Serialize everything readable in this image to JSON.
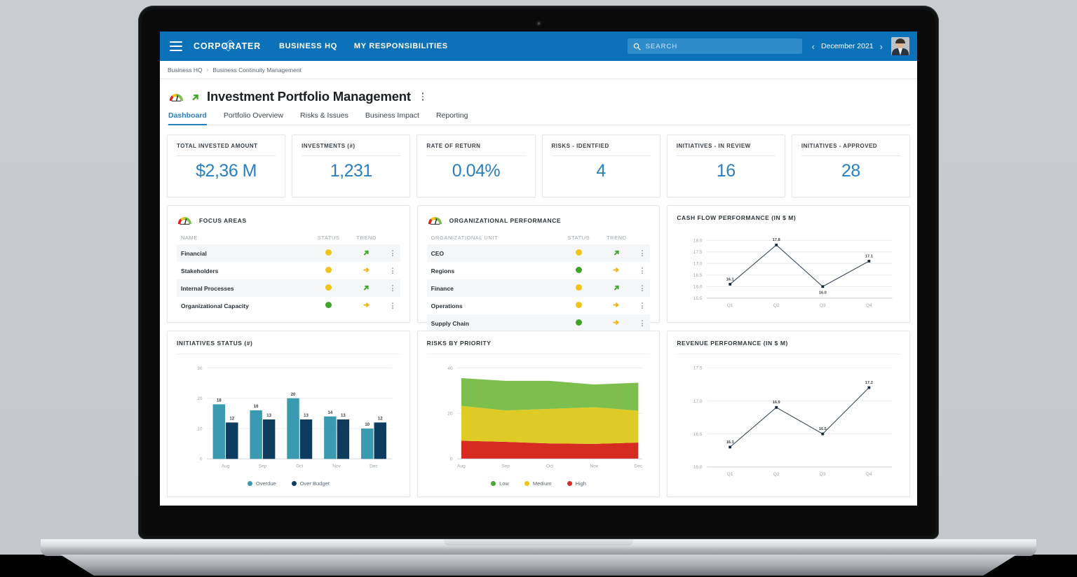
{
  "topbar": {
    "menu_icon": "hamburger-icon",
    "brand": "CORPORATER",
    "nav": [
      "BUSINESS HQ",
      "MY RESPONSIBILITIES"
    ],
    "search": {
      "icon": "search-icon",
      "placeholder": "SEARCH",
      "value": ""
    },
    "period": {
      "prev_icon": "chevron-left-icon",
      "label": "December 2021",
      "next_icon": "chevron-right-icon"
    },
    "avatar": "user-avatar"
  },
  "breadcrumb": {
    "items": [
      "Business HQ",
      "Business Continuity Management"
    ],
    "separator": "›"
  },
  "page": {
    "gauge_icon": "gauge-icon",
    "trend_icon": "arrow-up-right-icon",
    "title": "Investment Portfolio Management",
    "menu_icon": "kebab-menu-icon"
  },
  "tabs": [
    {
      "label": "Dashboard",
      "active": true
    },
    {
      "label": "Portfolio Overview",
      "active": false
    },
    {
      "label": "Risks & Issues",
      "active": false
    },
    {
      "label": "Business Impact",
      "active": false
    },
    {
      "label": "Reporting",
      "active": false
    }
  ],
  "kpis": [
    {
      "label": "TOTAL INVESTED AMOUNT",
      "value": "$2,36 M"
    },
    {
      "label": "INVESTMENTS (#)",
      "value": "1,231"
    },
    {
      "label": "RATE OF RETURN",
      "value": "0.04%"
    },
    {
      "label": "RISKS - IDENTFIED",
      "value": "4"
    },
    {
      "label": "INITIATIVES - IN REVIEW",
      "value": "16"
    },
    {
      "label": "INITIATIVES - APPROVED",
      "value": "28"
    }
  ],
  "focus_areas": {
    "title": "FOCUS AREAS",
    "icon": "gauge-icon",
    "columns": [
      "NAME",
      "STATUS",
      "TREND"
    ],
    "rows": [
      {
        "name": "Financial",
        "status": "yellow",
        "trend": "up-right",
        "menu": "kebab-menu-icon"
      },
      {
        "name": "Stakeholders",
        "status": "yellow",
        "trend": "right",
        "menu": "kebab-menu-icon"
      },
      {
        "name": "Internal Processes",
        "status": "yellow",
        "trend": "up-right",
        "menu": "kebab-menu-icon"
      },
      {
        "name": "Organizational Capacity",
        "status": "green",
        "trend": "right",
        "menu": "kebab-menu-icon"
      }
    ]
  },
  "org_performance": {
    "title": "ORGANIZATIONAL PERFORMANCE",
    "icon": "gauge-icon",
    "columns": [
      "ORGANIZATIONAL UNIT",
      "STATUS",
      "TREND"
    ],
    "rows": [
      {
        "name": "CEO",
        "status": "yellow",
        "trend": "up-right",
        "menu": "kebab-menu-icon"
      },
      {
        "name": "Regions",
        "status": "green",
        "trend": "right",
        "menu": "kebab-menu-icon"
      },
      {
        "name": "Finance",
        "status": "yellow",
        "trend": "up-right",
        "menu": "kebab-menu-icon"
      },
      {
        "name": "Operations",
        "status": "yellow",
        "trend": "right",
        "menu": "kebab-menu-icon"
      },
      {
        "name": "Supply Chain",
        "status": "green",
        "trend": "right",
        "menu": "kebab-menu-icon"
      }
    ]
  },
  "colors": {
    "brand_blue": "#0b72b9",
    "kpi_blue": "#2a7fbf",
    "status_yellow": "#f0c418",
    "status_green": "#3fa32a",
    "trend_green": "#3fa32a",
    "trend_yellow": "#f0b41a",
    "bar_overdue": "#3a9bb0",
    "bar_over_budget": "#0d3c5e",
    "risk_low": "#7dbf4c",
    "risk_medium": "#dfcb26",
    "risk_high": "#d62b20",
    "line_navy": "#2e3f52"
  },
  "chart_data": [
    {
      "id": "cash-flow",
      "type": "line",
      "title": "CASH FLOW PERFORMANCE (IN $ M)",
      "xlabel": "",
      "ylabel": "",
      "categories": [
        "Q1",
        "Q2",
        "Q3",
        "Q4"
      ],
      "values": [
        16.1,
        17.8,
        16.0,
        17.1
      ],
      "point_labels": [
        "16.1",
        "17.8",
        "16.0",
        "17.1"
      ],
      "yticks": [
        15.5,
        16.0,
        16.5,
        17.0,
        17.5,
        18.0
      ],
      "ytick_labels": [
        "15.5",
        "16.0",
        "16.5",
        "17.0",
        "17.5",
        "18.0"
      ],
      "ylim": [
        15.5,
        18.0
      ],
      "grid": true,
      "legend": "none"
    },
    {
      "id": "initiatives-status",
      "type": "bar",
      "title": "INITIATIVES STATUS (#)",
      "xlabel": "",
      "ylabel": "",
      "categories": [
        "Aug",
        "Sep",
        "Oct",
        "Nov",
        "Dec"
      ],
      "series": [
        {
          "name": "Overdue",
          "color": "#3a9bb0",
          "values": [
            18,
            16,
            20,
            14,
            10
          ]
        },
        {
          "name": "Over Budget",
          "color": "#0d3c5e",
          "values": [
            12,
            13,
            13,
            13,
            12
          ]
        }
      ],
      "yticks": [
        0,
        10,
        20,
        30
      ],
      "ytick_labels": [
        "0",
        "10",
        "20",
        "30"
      ],
      "ylim": [
        0,
        30
      ],
      "grid": true,
      "legend": "bottom"
    },
    {
      "id": "risks-by-priority",
      "type": "area",
      "title": "RISKS BY PRIORITY",
      "xlabel": "",
      "ylabel": "",
      "categories": [
        "Aug",
        "Sep",
        "Oct",
        "Nov",
        "Dec"
      ],
      "stacked": true,
      "series": [
        {
          "name": "High",
          "color": "#d62b20",
          "values": [
            8,
            7.5,
            6.8,
            6.6,
            7.2
          ]
        },
        {
          "name": "Medium",
          "color": "#dfcb26",
          "values": [
            15.3,
            13.8,
            15.2,
            16.1,
            14.0
          ]
        },
        {
          "name": "Low",
          "color": "#7dbf4c",
          "values": [
            12.2,
            13.0,
            12.3,
            10.0,
            12.3
          ]
        }
      ],
      "yticks": [
        0,
        20,
        40
      ],
      "ytick_labels": [
        "0",
        "20",
        "40"
      ],
      "ylim": [
        0,
        40
      ],
      "grid": true,
      "legend": "bottom",
      "legend_order": [
        "Low",
        "Medium",
        "High"
      ]
    },
    {
      "id": "revenue-performance",
      "type": "line",
      "title": "REVENUE PERFORMANCE (IN $ M)",
      "xlabel": "",
      "ylabel": "",
      "categories": [
        "Q1",
        "Q2",
        "Q3",
        "Q4"
      ],
      "values": [
        16.3,
        16.9,
        16.5,
        17.2
      ],
      "point_labels": [
        "16.3",
        "16.9",
        "16.5",
        "17.2"
      ],
      "yticks": [
        16.0,
        16.5,
        17.0,
        17.5
      ],
      "ytick_labels": [
        "16.0",
        "16.5",
        "17.0",
        "17.5"
      ],
      "ylim": [
        16.0,
        17.5
      ],
      "grid": true,
      "legend": "none"
    }
  ]
}
